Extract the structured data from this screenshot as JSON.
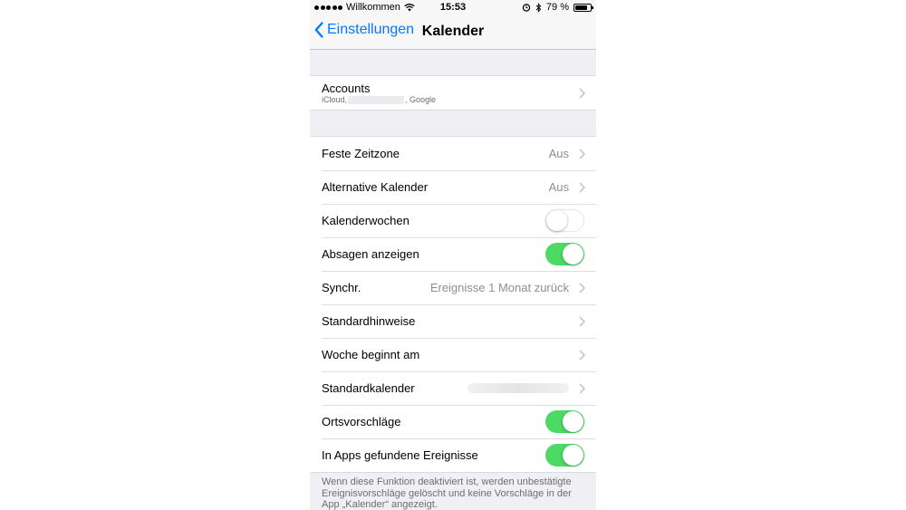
{
  "status": {
    "carrier": "Willkommen",
    "time": "15:53",
    "battery": "79 %",
    "battery_level": 0.79
  },
  "nav": {
    "back_label": "Einstellungen",
    "title": "Kalender"
  },
  "accounts": {
    "label": "Accounts",
    "sub_prefix": "iCloud,",
    "sub_suffix": ", Google"
  },
  "rows": [
    {
      "label": "Feste Zeitzone",
      "value": "Aus"
    },
    {
      "label": "Alternative Kalender",
      "value": "Aus"
    },
    {
      "label": "Kalenderwochen",
      "toggle": false
    },
    {
      "label": "Absagen anzeigen",
      "toggle": true
    },
    {
      "label": "Synchr.",
      "value": "Ereignisse 1 Monat zurück"
    },
    {
      "label": "Standardhinweise"
    },
    {
      "label": "Woche beginnt am"
    },
    {
      "label": "Standardkalender"
    },
    {
      "label": "Ortsvorschläge",
      "toggle": true
    },
    {
      "label": "In Apps gefundene Ereignisse",
      "toggle": true
    }
  ],
  "footer": "Wenn diese Funktion deaktiviert ist, werden unbestätigte Ereignisvorschläge gelöscht und keine Vorschläge in der App „Kalender“ angezeigt.",
  "colors": {
    "accent": "#007aff",
    "toggle_on": "#4cd964",
    "background": "#efeff4"
  }
}
